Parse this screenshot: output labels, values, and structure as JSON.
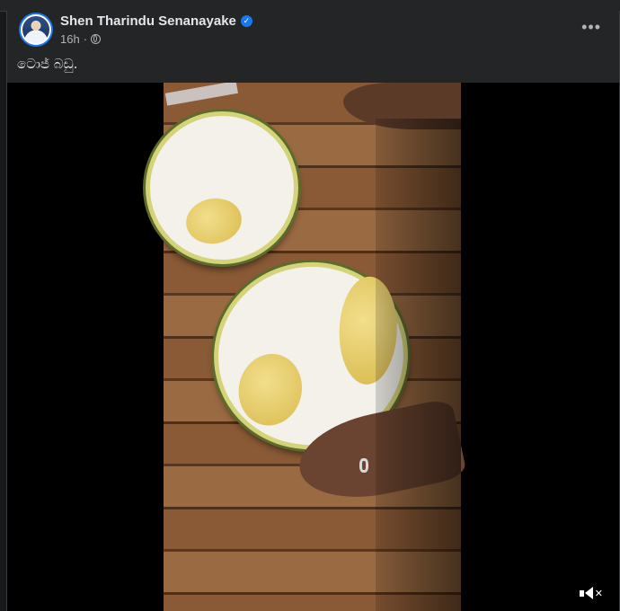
{
  "post": {
    "author": "Shen Tharindu Senanayake",
    "verified_icon": "verified-badge-icon",
    "time": "16h",
    "separator": "·",
    "audience_icon": "globe-icon",
    "more_label": "•••",
    "caption": "ටොජ් බඩු."
  },
  "video": {
    "subject": "",
    "mute_icon": "speaker-muted-icon",
    "mute_x": "✕"
  },
  "colors": {
    "card_bg": "#242526",
    "page_bg": "#18191a",
    "text_primary": "#e4e6eb",
    "text_secondary": "#b0b3b8",
    "verified_blue": "#1877f2"
  }
}
